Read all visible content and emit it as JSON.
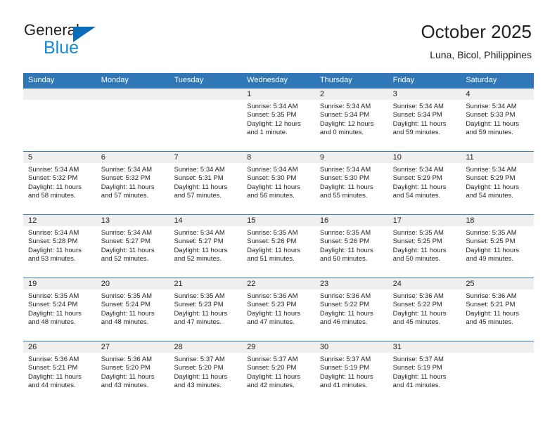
{
  "brand": {
    "word1": "General",
    "word2": "Blue",
    "accent_color": "#0b6cb7",
    "accent_color_light": "#1689cc"
  },
  "header": {
    "title": "October 2025",
    "subtitle": "Luna, Bicol, Philippines"
  },
  "theme": {
    "header_row_color": "#2f77b7",
    "daynum_bg": "#efefef",
    "text_color": "#231f20"
  },
  "weekday_headers": [
    "Sunday",
    "Monday",
    "Tuesday",
    "Wednesday",
    "Thursday",
    "Friday",
    "Saturday"
  ],
  "weeks": [
    [
      {
        "day": "",
        "lines": []
      },
      {
        "day": "",
        "lines": []
      },
      {
        "day": "",
        "lines": []
      },
      {
        "day": "1",
        "lines": [
          "Sunrise: 5:34 AM",
          "Sunset: 5:35 PM",
          "Daylight: 12 hours",
          "and 1 minute."
        ]
      },
      {
        "day": "2",
        "lines": [
          "Sunrise: 5:34 AM",
          "Sunset: 5:34 PM",
          "Daylight: 12 hours",
          "and 0 minutes."
        ]
      },
      {
        "day": "3",
        "lines": [
          "Sunrise: 5:34 AM",
          "Sunset: 5:34 PM",
          "Daylight: 11 hours",
          "and 59 minutes."
        ]
      },
      {
        "day": "4",
        "lines": [
          "Sunrise: 5:34 AM",
          "Sunset: 5:33 PM",
          "Daylight: 11 hours",
          "and 59 minutes."
        ]
      }
    ],
    [
      {
        "day": "5",
        "lines": [
          "Sunrise: 5:34 AM",
          "Sunset: 5:32 PM",
          "Daylight: 11 hours",
          "and 58 minutes."
        ]
      },
      {
        "day": "6",
        "lines": [
          "Sunrise: 5:34 AM",
          "Sunset: 5:32 PM",
          "Daylight: 11 hours",
          "and 57 minutes."
        ]
      },
      {
        "day": "7",
        "lines": [
          "Sunrise: 5:34 AM",
          "Sunset: 5:31 PM",
          "Daylight: 11 hours",
          "and 57 minutes."
        ]
      },
      {
        "day": "8",
        "lines": [
          "Sunrise: 5:34 AM",
          "Sunset: 5:30 PM",
          "Daylight: 11 hours",
          "and 56 minutes."
        ]
      },
      {
        "day": "9",
        "lines": [
          "Sunrise: 5:34 AM",
          "Sunset: 5:30 PM",
          "Daylight: 11 hours",
          "and 55 minutes."
        ]
      },
      {
        "day": "10",
        "lines": [
          "Sunrise: 5:34 AM",
          "Sunset: 5:29 PM",
          "Daylight: 11 hours",
          "and 54 minutes."
        ]
      },
      {
        "day": "11",
        "lines": [
          "Sunrise: 5:34 AM",
          "Sunset: 5:29 PM",
          "Daylight: 11 hours",
          "and 54 minutes."
        ]
      }
    ],
    [
      {
        "day": "12",
        "lines": [
          "Sunrise: 5:34 AM",
          "Sunset: 5:28 PM",
          "Daylight: 11 hours",
          "and 53 minutes."
        ]
      },
      {
        "day": "13",
        "lines": [
          "Sunrise: 5:34 AM",
          "Sunset: 5:27 PM",
          "Daylight: 11 hours",
          "and 52 minutes."
        ]
      },
      {
        "day": "14",
        "lines": [
          "Sunrise: 5:34 AM",
          "Sunset: 5:27 PM",
          "Daylight: 11 hours",
          "and 52 minutes."
        ]
      },
      {
        "day": "15",
        "lines": [
          "Sunrise: 5:35 AM",
          "Sunset: 5:26 PM",
          "Daylight: 11 hours",
          "and 51 minutes."
        ]
      },
      {
        "day": "16",
        "lines": [
          "Sunrise: 5:35 AM",
          "Sunset: 5:26 PM",
          "Daylight: 11 hours",
          "and 50 minutes."
        ]
      },
      {
        "day": "17",
        "lines": [
          "Sunrise: 5:35 AM",
          "Sunset: 5:25 PM",
          "Daylight: 11 hours",
          "and 50 minutes."
        ]
      },
      {
        "day": "18",
        "lines": [
          "Sunrise: 5:35 AM",
          "Sunset: 5:25 PM",
          "Daylight: 11 hours",
          "and 49 minutes."
        ]
      }
    ],
    [
      {
        "day": "19",
        "lines": [
          "Sunrise: 5:35 AM",
          "Sunset: 5:24 PM",
          "Daylight: 11 hours",
          "and 48 minutes."
        ]
      },
      {
        "day": "20",
        "lines": [
          "Sunrise: 5:35 AM",
          "Sunset: 5:24 PM",
          "Daylight: 11 hours",
          "and 48 minutes."
        ]
      },
      {
        "day": "21",
        "lines": [
          "Sunrise: 5:35 AM",
          "Sunset: 5:23 PM",
          "Daylight: 11 hours",
          "and 47 minutes."
        ]
      },
      {
        "day": "22",
        "lines": [
          "Sunrise: 5:36 AM",
          "Sunset: 5:23 PM",
          "Daylight: 11 hours",
          "and 47 minutes."
        ]
      },
      {
        "day": "23",
        "lines": [
          "Sunrise: 5:36 AM",
          "Sunset: 5:22 PM",
          "Daylight: 11 hours",
          "and 46 minutes."
        ]
      },
      {
        "day": "24",
        "lines": [
          "Sunrise: 5:36 AM",
          "Sunset: 5:22 PM",
          "Daylight: 11 hours",
          "and 45 minutes."
        ]
      },
      {
        "day": "25",
        "lines": [
          "Sunrise: 5:36 AM",
          "Sunset: 5:21 PM",
          "Daylight: 11 hours",
          "and 45 minutes."
        ]
      }
    ],
    [
      {
        "day": "26",
        "lines": [
          "Sunrise: 5:36 AM",
          "Sunset: 5:21 PM",
          "Daylight: 11 hours",
          "and 44 minutes."
        ]
      },
      {
        "day": "27",
        "lines": [
          "Sunrise: 5:36 AM",
          "Sunset: 5:20 PM",
          "Daylight: 11 hours",
          "and 43 minutes."
        ]
      },
      {
        "day": "28",
        "lines": [
          "Sunrise: 5:37 AM",
          "Sunset: 5:20 PM",
          "Daylight: 11 hours",
          "and 43 minutes."
        ]
      },
      {
        "day": "29",
        "lines": [
          "Sunrise: 5:37 AM",
          "Sunset: 5:20 PM",
          "Daylight: 11 hours",
          "and 42 minutes."
        ]
      },
      {
        "day": "30",
        "lines": [
          "Sunrise: 5:37 AM",
          "Sunset: 5:19 PM",
          "Daylight: 11 hours",
          "and 41 minutes."
        ]
      },
      {
        "day": "31",
        "lines": [
          "Sunrise: 5:37 AM",
          "Sunset: 5:19 PM",
          "Daylight: 11 hours",
          "and 41 minutes."
        ]
      },
      {
        "day": "",
        "lines": []
      }
    ]
  ]
}
